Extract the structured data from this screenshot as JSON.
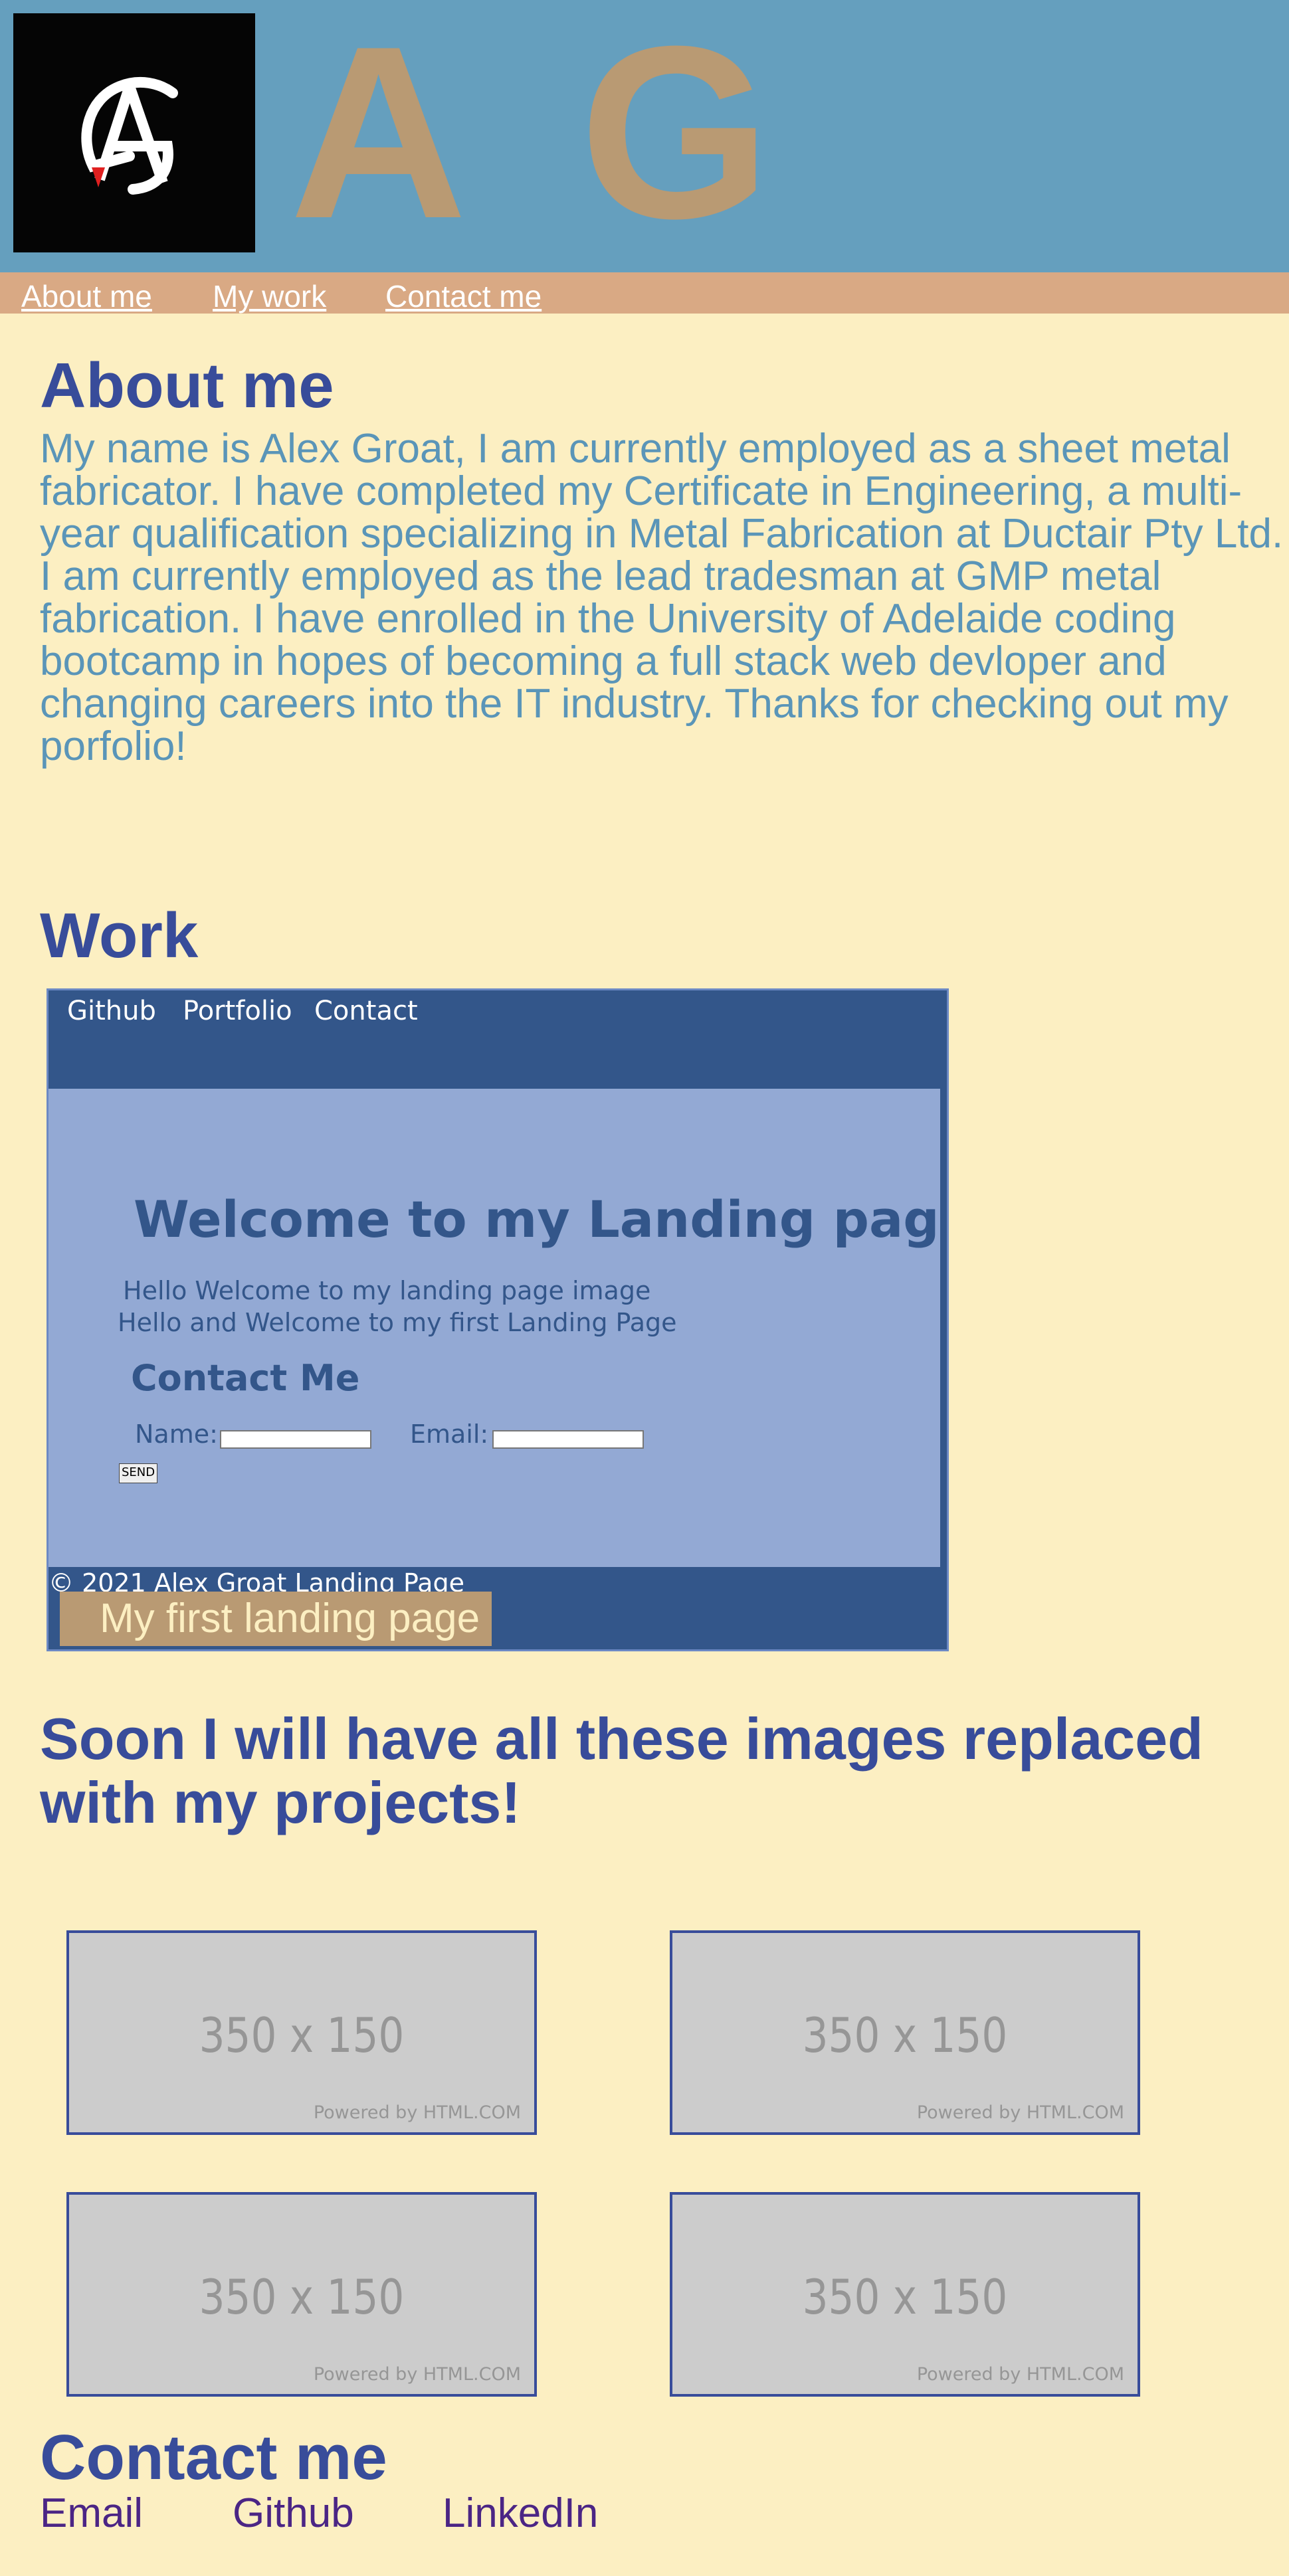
{
  "header": {
    "logo_alt": "AG logo",
    "initials": "A G"
  },
  "nav": {
    "items": [
      "About me",
      "My work",
      "Contact me"
    ]
  },
  "about": {
    "heading": "About me",
    "text": "My name is Alex Groat, I am currently employed as a sheet metal fabricator. I have completed my Certificate in Engineering, a multi-year qualification specializing in Metal Fabrication at Ductair Pty Ltd. I am currently employed as the lead tradesman at GMP metal fabrication. I have enrolled in the University of Adelaide coding bootcamp in hopes of becoming a full stack web devloper and changing careers into the IT industry. Thanks for checking out my porfolio!"
  },
  "work": {
    "heading": "Work",
    "featured": {
      "nav": [
        "Github",
        "Portfolio",
        "Contact"
      ],
      "title": "Welcome to my Landing page",
      "image_alt": "Hello Welcome to my landing page image",
      "intro": "Hello and Welcome to my first Landing Page",
      "contact_heading": "Contact Me",
      "name_label": "Name:",
      "email_label": "Email:",
      "send_label": "SEND",
      "footer": "© 2021 Alex Groat Landing Page",
      "caption": "My first landing page"
    },
    "soon_heading": "Soon I will have all these images replaced with my projects!",
    "placeholders": [
      {
        "size": "350 x 150",
        "powered": "Powered by HTML.COM"
      },
      {
        "size": "350 x 150",
        "powered": "Powered by HTML.COM"
      },
      {
        "size": "350 x 150",
        "powered": "Powered by HTML.COM"
      },
      {
        "size": "350 x 150",
        "powered": "Powered by HTML.COM"
      }
    ]
  },
  "contact": {
    "heading": "Contact me",
    "links": [
      "Email",
      "Github",
      "LinkedIn"
    ]
  },
  "colors": {
    "header_bg": "#659fbe",
    "nav_bg": "#d9a984",
    "page_bg": "#fcefc2",
    "heading": "#384c9a",
    "about_text": "#5a95b8",
    "initials": "#b99a73",
    "contact_link": "#4b2585"
  }
}
